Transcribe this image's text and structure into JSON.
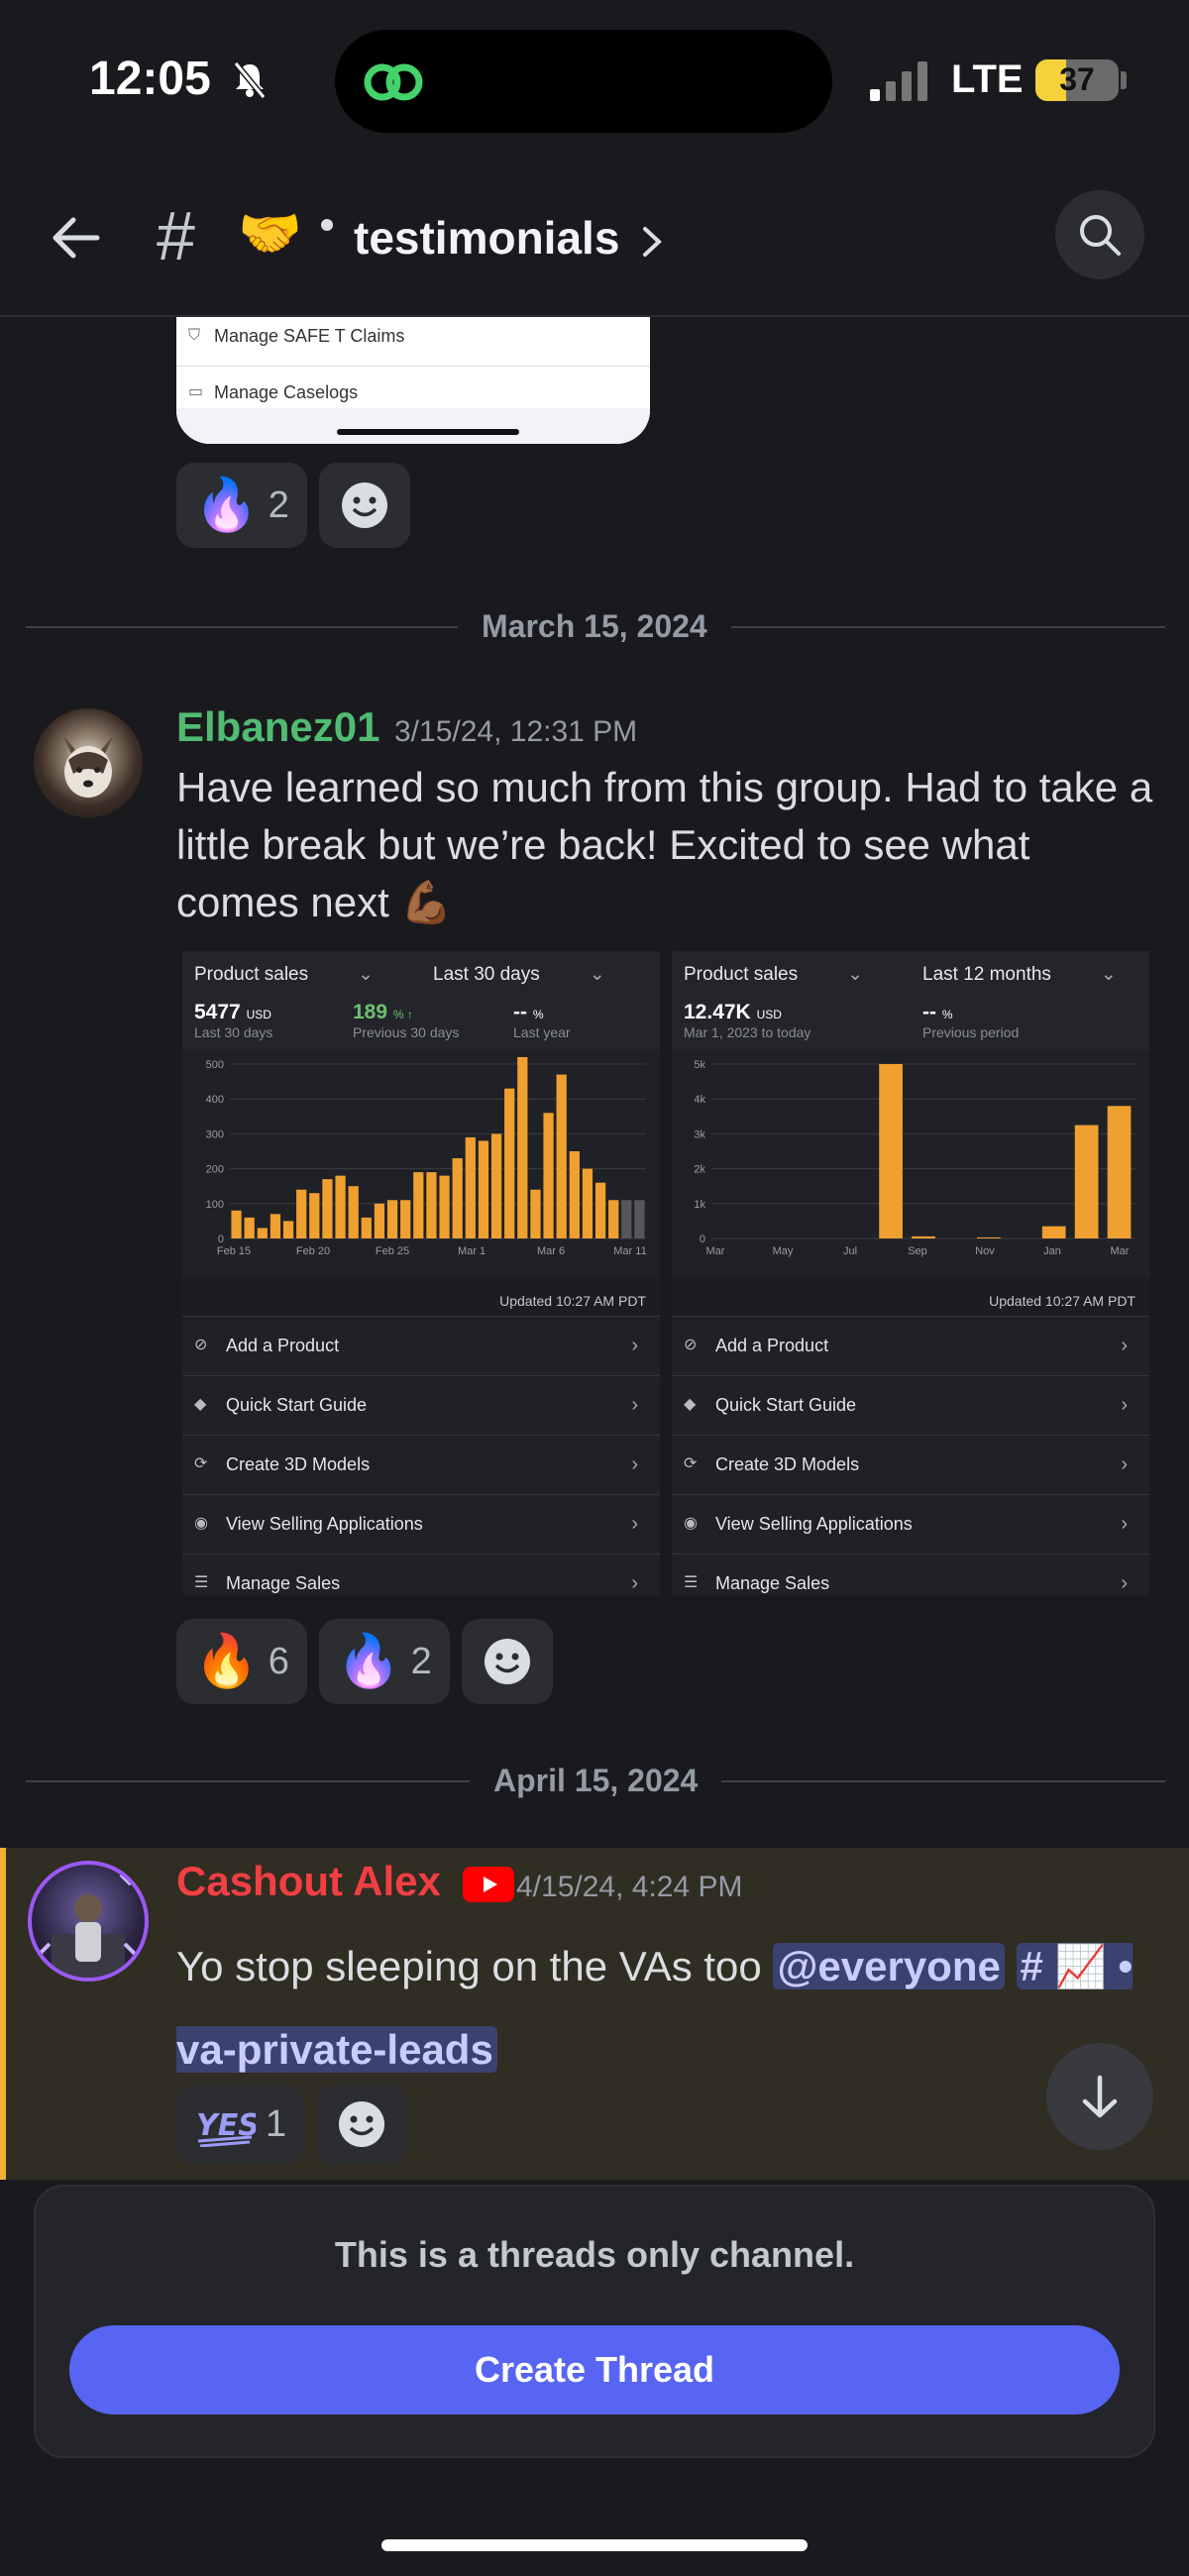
{
  "status_bar": {
    "time": "12:05",
    "network": "LTE",
    "battery": "37",
    "battery_level": 0.37
  },
  "header": {
    "channel_emoji": "🤝",
    "channel_name": "testimonials"
  },
  "prev_card": {
    "row1": "Manage SAFE T Claims",
    "row2": "Manage Caselogs"
  },
  "prev_reactions": [
    {
      "emoji": "🔥",
      "count": "2"
    }
  ],
  "divider1": "March 15, 2024",
  "message1": {
    "author": "Elbanez01",
    "author_color": "#4fbc72",
    "timestamp": "3/15/24, 12:31 PM",
    "text": "Have learned so much from this group. Had to take a little break but we’re back!  Excited to see what comes next 💪🏾"
  },
  "attachments": [
    {
      "dropdown1": "Product sales",
      "dropdown2": "Last 30 days",
      "m1_value": "5477",
      "m1_unit": "USD",
      "m1_sub": "Last 30 days",
      "m2_value": "189",
      "m2_unit": "% ↑",
      "m2_sub": "Previous 30 days",
      "m3_value": "--",
      "m3_unit": "%",
      "m3_sub": "Last year",
      "updated": "Updated 10:27 AM PDT",
      "menu": [
        "Add a Product",
        "Quick Start Guide",
        "Create 3D Models",
        "View Selling Applications",
        "Manage Sales"
      ]
    },
    {
      "dropdown1": "Product sales",
      "dropdown2": "Last 12 months",
      "m1_value": "12.47K",
      "m1_unit": "USD",
      "m1_sub": "Mar 1, 2023 to today",
      "m2_value": "--",
      "m2_unit": "%",
      "m2_sub": "Previous period",
      "updated": "Updated 10:27 AM PDT",
      "menu": [
        "Add a Product",
        "Quick Start Guide",
        "Create 3D Models",
        "View Selling Applications",
        "Manage Sales"
      ]
    }
  ],
  "chart_data": [
    {
      "type": "bar",
      "title": "Product sales",
      "yticks": [
        "0",
        "100",
        "200",
        "300",
        "400",
        "500"
      ],
      "ylim": [
        0,
        500
      ],
      "xticks": [
        "Feb 15",
        "Feb 20",
        "Feb 25",
        "Mar 1",
        "Mar 6",
        "Mar 11"
      ],
      "values": [
        80,
        60,
        30,
        70,
        50,
        140,
        130,
        170,
        180,
        150,
        60,
        100,
        110,
        110,
        190,
        190,
        180,
        230,
        290,
        280,
        300,
        430,
        520,
        140,
        360,
        470,
        250,
        200,
        160,
        110,
        110,
        110
      ]
    },
    {
      "type": "bar",
      "title": "Product sales",
      "yticks": [
        "0",
        "1k",
        "2k",
        "3k",
        "4k",
        "5k"
      ],
      "ylim": [
        0,
        5000
      ],
      "xticks": [
        "Mar",
        "May",
        "Jul",
        "Sep",
        "Nov",
        "Jan",
        "Mar"
      ],
      "categories": [
        "Mar",
        "Apr",
        "May",
        "Jun",
        "Jul",
        "Aug",
        "Sep",
        "Oct",
        "Nov",
        "Dec",
        "Jan",
        "Feb",
        "Mar"
      ],
      "values": [
        0,
        0,
        0,
        0,
        0,
        5000,
        60,
        0,
        30,
        0,
        350,
        3250,
        3800
      ]
    }
  ],
  "msg1_reactions": [
    {
      "emoji": "🔥",
      "count": "6"
    },
    {
      "emoji": "🔥",
      "count": "2"
    }
  ],
  "divider2": "April 15, 2024",
  "message2": {
    "author": "Cashout Alex",
    "author_color": "#f23f43",
    "timestamp": "4/15/24, 4:24 PM",
    "text": "Yo stop sleeping on the VAs too",
    "mention": "@everyone",
    "channel_link_hash": "#",
    "channel_link_emoji": "📈",
    "channel_link_name": "va-private-leads"
  },
  "msg2_reactions": [
    {
      "emoji": "YES",
      "count": "1"
    }
  ],
  "threads_panel": {
    "text": "This is a threads only channel.",
    "button": "Create Thread"
  },
  "colors": {
    "accent": "#5865f2",
    "bar": "#f0a030",
    "highlight_border": "#f0b232"
  }
}
